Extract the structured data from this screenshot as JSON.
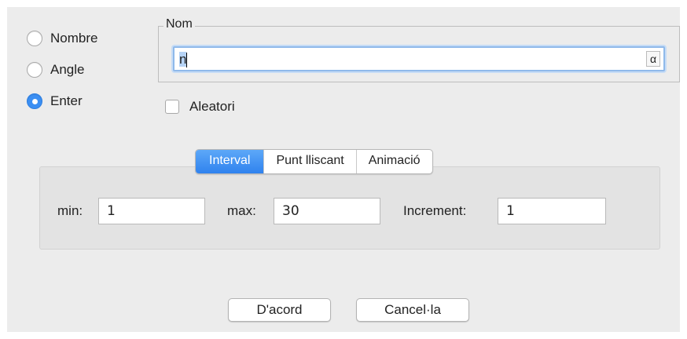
{
  "type_options": [
    {
      "label": "Nombre",
      "checked": false
    },
    {
      "label": "Angle",
      "checked": false
    },
    {
      "label": "Enter",
      "checked": true
    }
  ],
  "name_group": {
    "legend": "Nom",
    "value": "n",
    "alpha_button": "α"
  },
  "random": {
    "label": "Aleatori",
    "checked": false
  },
  "tabs": [
    {
      "label": "Interval",
      "active": true
    },
    {
      "label": "Punt lliscant",
      "active": false
    },
    {
      "label": "Animació",
      "active": false
    }
  ],
  "interval": {
    "min_label": "min:",
    "min_value": "1",
    "max_label": "max:",
    "max_value": "30",
    "increment_label": "Increment:",
    "increment_value": "1"
  },
  "buttons": {
    "ok": "D'acord",
    "cancel": "Cancel·la"
  },
  "colors": {
    "accent": "#3b8ff3",
    "dialog_bg": "#ececec"
  }
}
